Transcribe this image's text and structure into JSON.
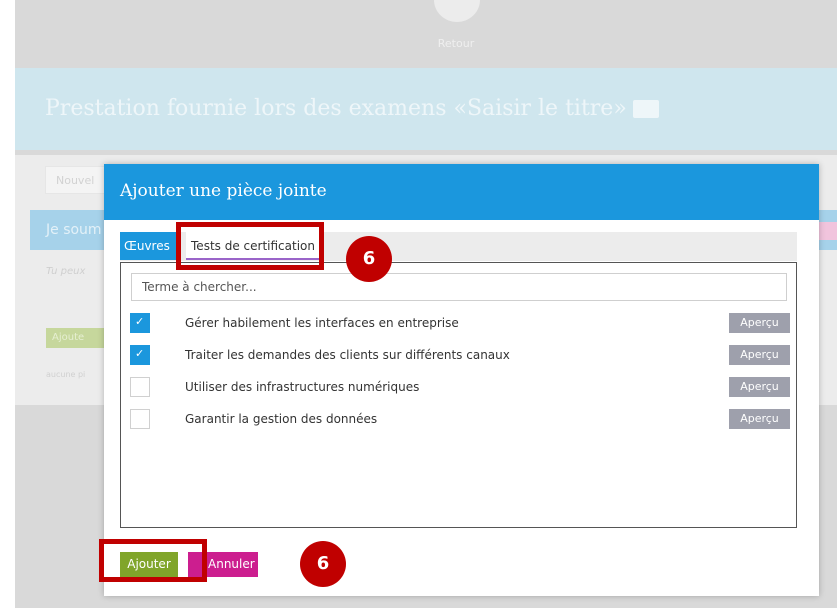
{
  "background": {
    "retour_label": "Retour",
    "title": "Prestation fournie lors des examens  «Saisir le titre»",
    "input_text": "Nouvel",
    "bar_text": "Je soum",
    "italic_text": "Tu peux",
    "green_button": "Ajoute",
    "small_text": "aucune pi"
  },
  "modal": {
    "title": "Ajouter une pièce jointe",
    "tabs": [
      {
        "label": "Œuvres",
        "active": true
      },
      {
        "label": "Tests de certification",
        "active": false
      }
    ],
    "search_placeholder": "Terme à chercher...",
    "items": [
      {
        "label": "Gérer habilement les interfaces en entreprise",
        "checked": true,
        "action": "Aperçu"
      },
      {
        "label": "Traiter les demandes des clients sur différents canaux",
        "checked": true,
        "action": "Aperçu"
      },
      {
        "label": "Utiliser des infrastructures numériques",
        "checked": false,
        "action": "Aperçu"
      },
      {
        "label": "Garantir la gestion des données",
        "checked": false,
        "action": "Aperçu"
      }
    ],
    "buttons": {
      "add": "Ajouter",
      "cancel": "Annuler"
    }
  },
  "annotations": {
    "top_badge": "6",
    "bottom_badge": "6"
  },
  "colors": {
    "accent_blue": "#1b97dd",
    "callout_red": "#c00000",
    "add_green": "#80a52a",
    "cancel_magenta": "#cc1e8f",
    "apercu_grey": "#9ea0ac"
  },
  "icons": [
    "keyboard-icon",
    "checkmark-icon"
  ]
}
